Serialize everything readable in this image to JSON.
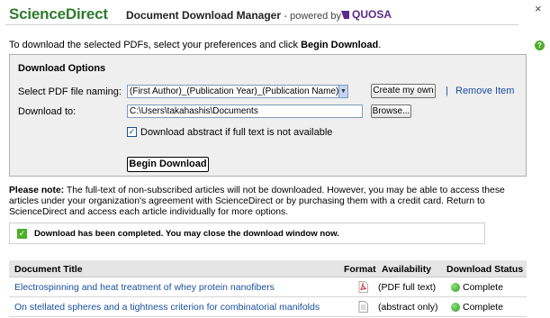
{
  "header": {
    "brand": "ScienceDirect",
    "title": "Document Download Manager",
    "powered_by": "- powered by",
    "partner": "QUOSA",
    "close": "×",
    "help": "?"
  },
  "intro": {
    "text": "To download the selected PDFs, select your preferences and click ",
    "action": "Begin Download",
    "end": "."
  },
  "options": {
    "title": "Download Options",
    "naming_label": "Select PDF file naming:",
    "naming_value": "(First Author)_(Publication Year)_(Publication Name).pdf",
    "create_button": "Create my own",
    "separator": "|",
    "remove_link": "Remove Item",
    "download_to_label": "Download to:",
    "download_to_value": "C:\\Users\\takahashis\\Documents",
    "browse_button": "Browse...",
    "abstract_checkbox_label": "Download abstract if full text is not available",
    "abstract_checked": true,
    "begin_button": "Begin Download"
  },
  "note": {
    "label": "Please note:",
    "text": " The full-text of non-subscribed articles will not be downloaded. However, you may be able to access these articles under your organization's agreement with ScienceDirect or by purchasing them with a credit card. Return to ScienceDirect and access each article individually for more options."
  },
  "completion": {
    "message": "Download has been completed. You may close the download window now."
  },
  "table": {
    "columns": [
      "Document Title",
      "Format",
      "Availability",
      "Download Status"
    ],
    "rows": [
      {
        "title": "Electrospinning and heat treatment of whey protein nanofibers",
        "format_icon": "pdf-icon",
        "availability": "(PDF full text)",
        "status": "Complete"
      },
      {
        "title": "On stellated spheres and a tightness criterion for combinatorial manifolds",
        "format_icon": "document-icon",
        "availability": "(abstract only)",
        "status": "Complete"
      }
    ]
  },
  "colors": {
    "brand_green": "#2f7b2f",
    "quosa_purple": "#5b2a86",
    "link_blue": "#1a4fa0",
    "status_green": "#4caf2c"
  }
}
